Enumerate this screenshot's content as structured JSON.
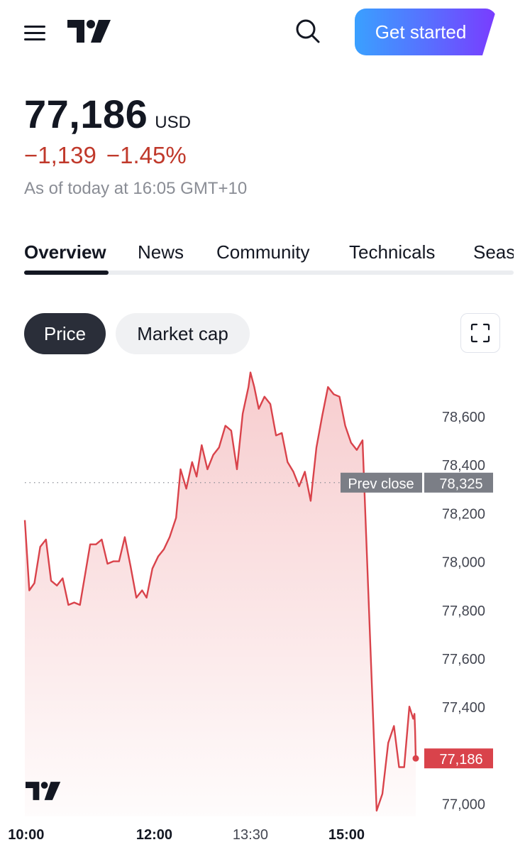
{
  "header": {
    "menu_icon": "hamburger-icon",
    "logo_icon": "tradingview-logo",
    "search_icon": "search-icon",
    "cta_label": "Get started"
  },
  "quote": {
    "price": "77,186",
    "currency": "USD",
    "change_abs": "−1,139",
    "change_pct": "−1.45%",
    "as_of": "As of today at 16:05 GMT+10"
  },
  "tabs": [
    {
      "label": "Overview",
      "active": true
    },
    {
      "label": "News",
      "active": false
    },
    {
      "label": "Community",
      "active": false
    },
    {
      "label": "Technicals",
      "active": false
    },
    {
      "label": "Seas",
      "active": false
    }
  ],
  "chart_controls": {
    "price_label": "Price",
    "market_cap_label": "Market cap",
    "fullscreen_icon": "fullscreen-icon"
  },
  "colors": {
    "negative": "#c0392b",
    "line": "#d9434b",
    "cta_start": "#3aa0ff",
    "cta_end": "#7a3bff"
  },
  "chart_data": {
    "type": "area",
    "ylim": [
      76950,
      78820
    ],
    "y_ticks": [
      "78,600",
      "78,400",
      "78,200",
      "78,000",
      "77,800",
      "77,600",
      "77,400",
      "77,000"
    ],
    "y_tick_values": [
      78600,
      78400,
      78200,
      78000,
      77800,
      77600,
      77400,
      77000
    ],
    "x_ticks": [
      "10:00",
      "12:00",
      "13:30",
      "15:00"
    ],
    "x_tick_bold": [
      true,
      true,
      false,
      true
    ],
    "x_tick_values": [
      10.0,
      12.0,
      13.5,
      15.0
    ],
    "xlim": [
      9.98,
      16.08
    ],
    "prev_close": {
      "label": "Prev close",
      "value_label": "78,325",
      "value": 78325
    },
    "last": {
      "value_label": "77,186",
      "value": 77186
    },
    "series": [
      {
        "points": [
          [
            9.98,
            78170
          ],
          [
            10.05,
            77880
          ],
          [
            10.13,
            77910
          ],
          [
            10.22,
            78060
          ],
          [
            10.31,
            78090
          ],
          [
            10.39,
            77920
          ],
          [
            10.48,
            77900
          ],
          [
            10.57,
            77930
          ],
          [
            10.66,
            77820
          ],
          [
            10.75,
            77830
          ],
          [
            10.84,
            77820
          ],
          [
            10.93,
            77960
          ],
          [
            11.0,
            78070
          ],
          [
            11.09,
            78070
          ],
          [
            11.18,
            78090
          ],
          [
            11.27,
            77990
          ],
          [
            11.36,
            78000
          ],
          [
            11.45,
            78000
          ],
          [
            11.54,
            78100
          ],
          [
            11.63,
            77980
          ],
          [
            11.72,
            77850
          ],
          [
            11.81,
            77880
          ],
          [
            11.88,
            77850
          ],
          [
            11.97,
            77970
          ],
          [
            12.06,
            78020
          ],
          [
            12.15,
            78050
          ],
          [
            12.24,
            78100
          ],
          [
            12.34,
            78180
          ],
          [
            12.41,
            78380
          ],
          [
            12.5,
            78300
          ],
          [
            12.59,
            78410
          ],
          [
            12.66,
            78350
          ],
          [
            12.74,
            78480
          ],
          [
            12.83,
            78380
          ],
          [
            12.92,
            78440
          ],
          [
            13.01,
            78470
          ],
          [
            13.11,
            78560
          ],
          [
            13.2,
            78540
          ],
          [
            13.29,
            78380
          ],
          [
            13.38,
            78610
          ],
          [
            13.47,
            78720
          ],
          [
            13.5,
            78780
          ],
          [
            13.56,
            78720
          ],
          [
            13.63,
            78630
          ],
          [
            13.72,
            78680
          ],
          [
            13.81,
            78650
          ],
          [
            13.9,
            78520
          ],
          [
            13.99,
            78530
          ],
          [
            14.08,
            78410
          ],
          [
            14.17,
            78370
          ],
          [
            14.26,
            78310
          ],
          [
            14.35,
            78370
          ],
          [
            14.44,
            78250
          ],
          [
            14.53,
            78470
          ],
          [
            14.62,
            78600
          ],
          [
            14.71,
            78720
          ],
          [
            14.8,
            78690
          ],
          [
            14.89,
            78680
          ],
          [
            14.98,
            78560
          ],
          [
            15.07,
            78490
          ],
          [
            15.16,
            78460
          ],
          [
            15.25,
            78500
          ],
          [
            15.47,
            76970
          ],
          [
            15.56,
            77040
          ],
          [
            15.65,
            77250
          ],
          [
            15.74,
            77320
          ],
          [
            15.82,
            77150
          ],
          [
            15.9,
            77150
          ],
          [
            15.98,
            77400
          ],
          [
            16.04,
            77350
          ],
          [
            16.06,
            77370
          ],
          [
            16.07,
            77300
          ],
          [
            16.08,
            77186
          ]
        ]
      }
    ]
  }
}
